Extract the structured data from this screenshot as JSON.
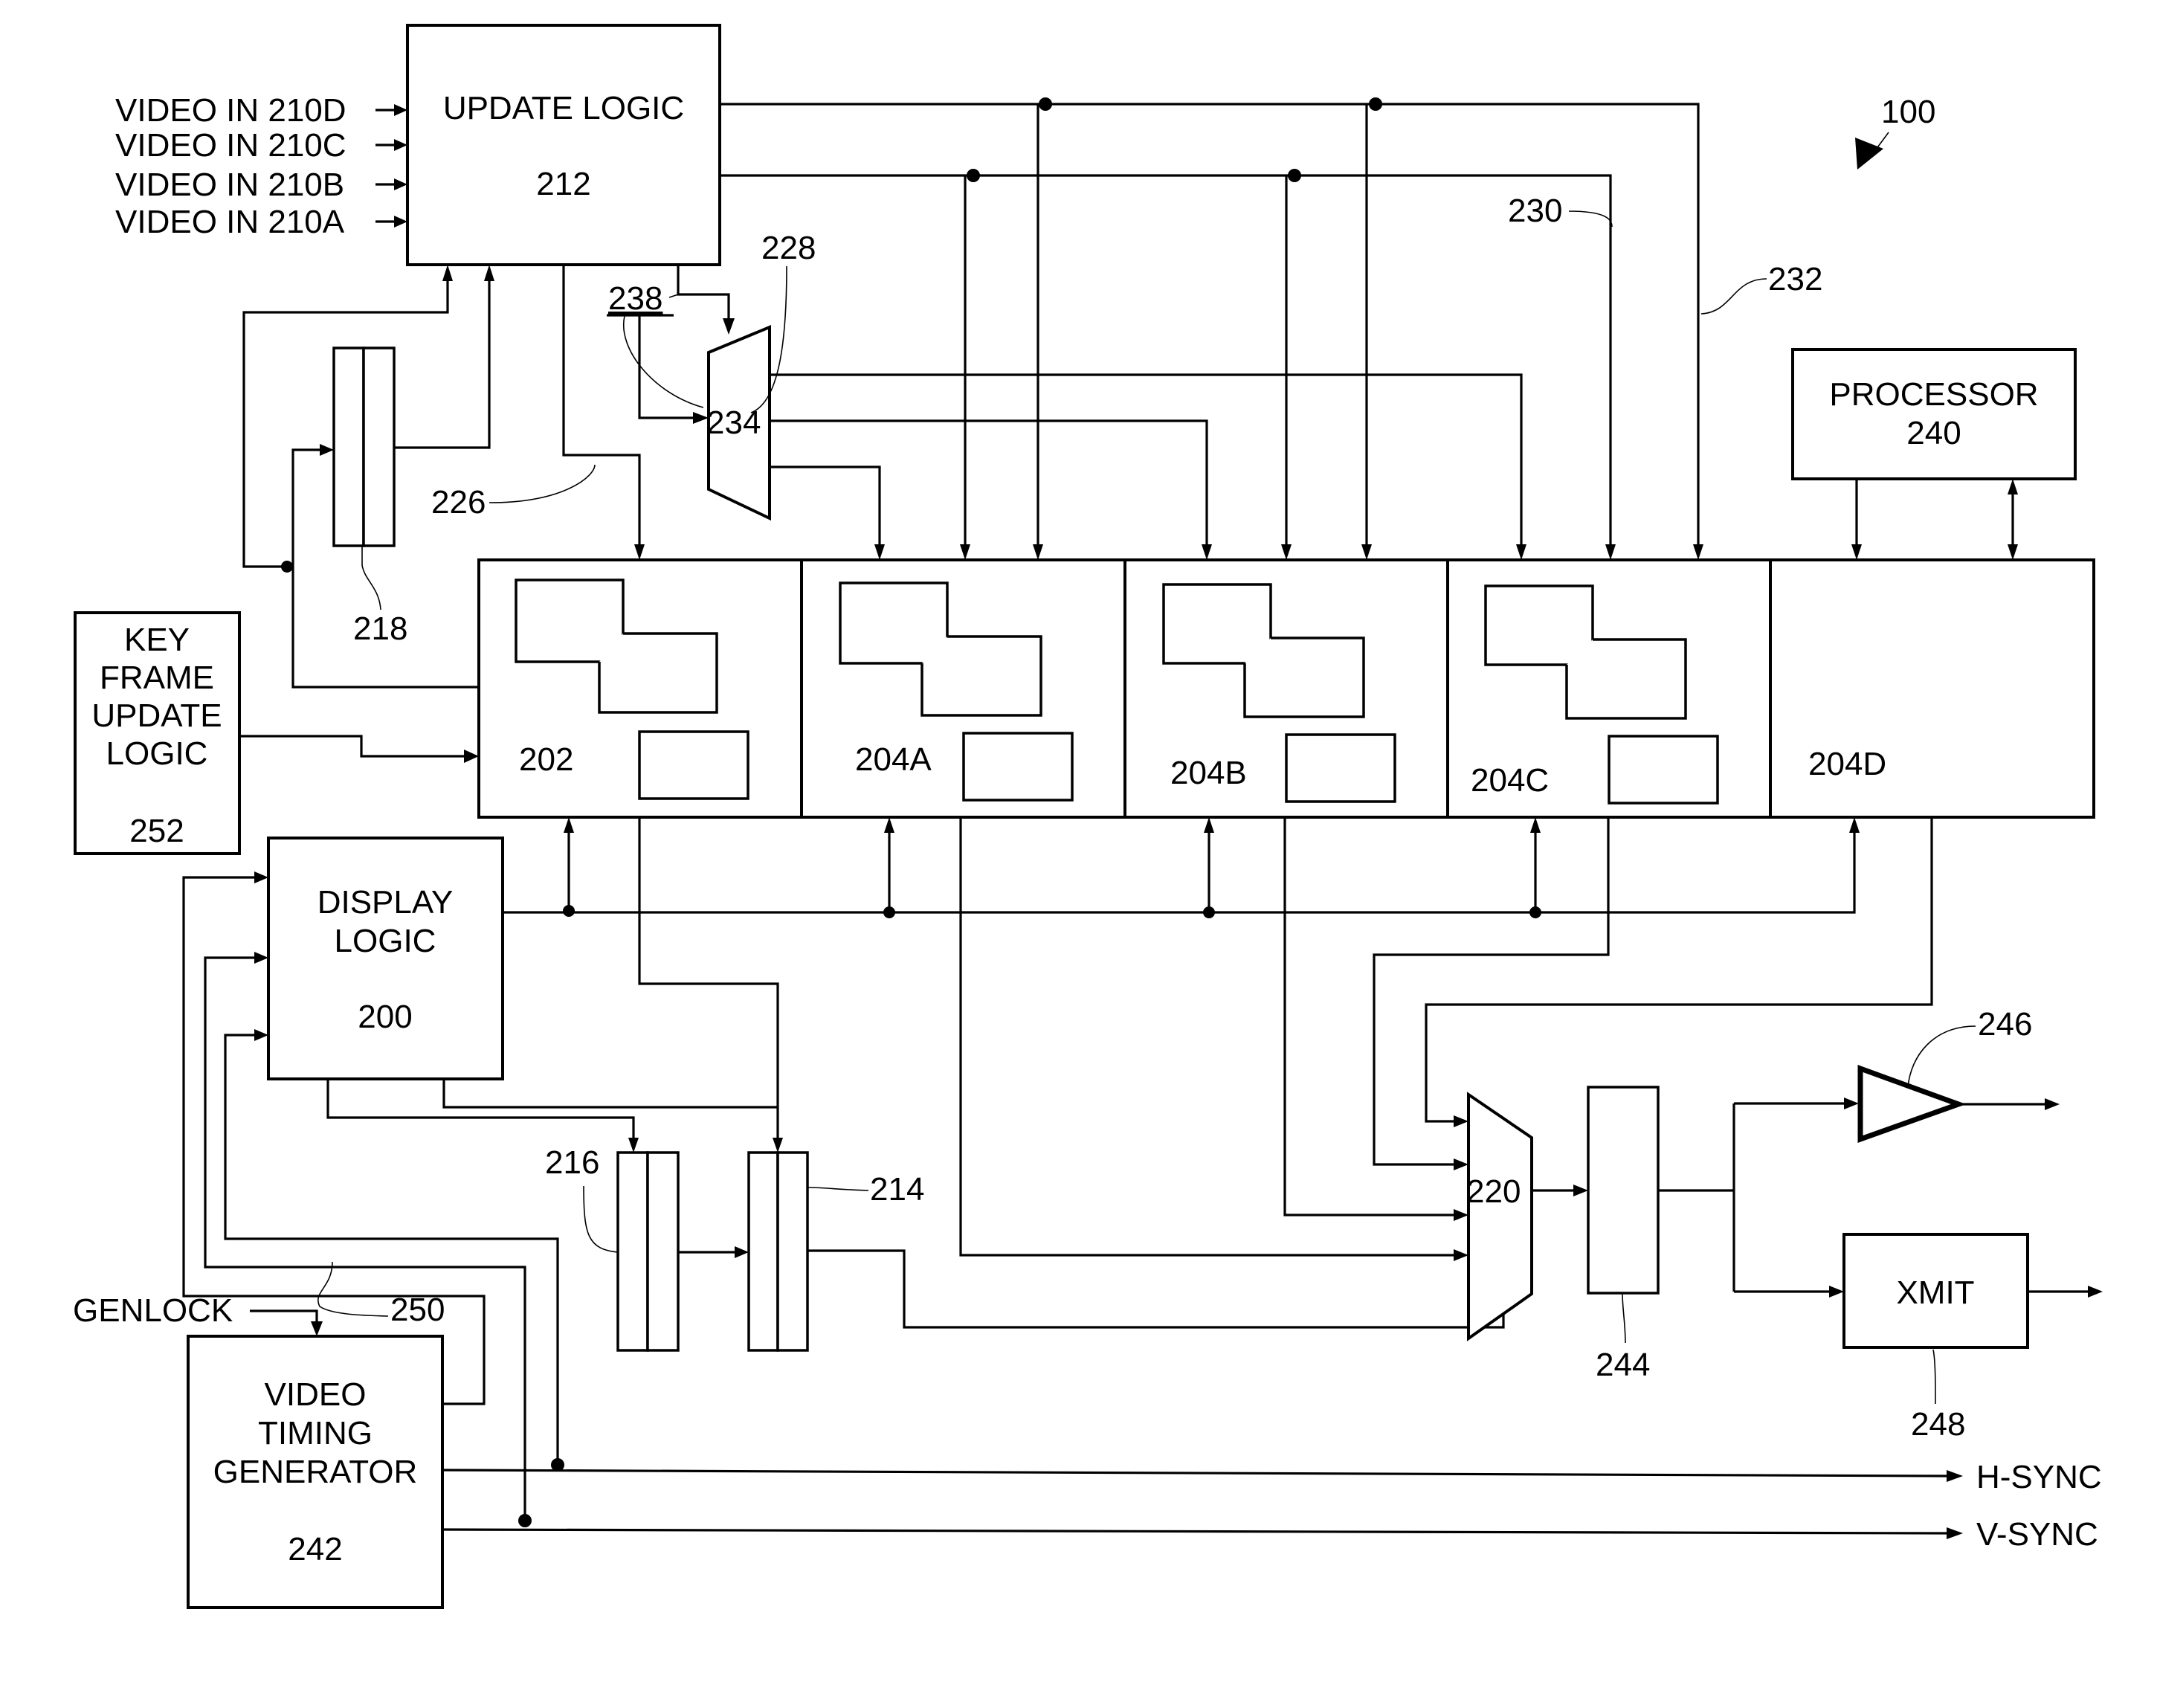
{
  "figure": {
    "reference": "100"
  },
  "inputs": [
    {
      "label": "VIDEO IN 210D"
    },
    {
      "label": "VIDEO IN 210C"
    },
    {
      "label": "VIDEO IN 210B"
    },
    {
      "label": "VIDEO IN 210A"
    }
  ],
  "blocks": {
    "update_logic": {
      "title": "UPDATE LOGIC",
      "ref": "212"
    },
    "processor": {
      "title": "PROCESSOR",
      "ref": "240"
    },
    "key_frame": {
      "line1": "KEY",
      "line2": "FRAME",
      "line3": "UPDATE",
      "line4": "LOGIC",
      "ref": "252"
    },
    "display_logic": {
      "line1": "DISPLAY",
      "line2": "LOGIC",
      "ref": "200"
    },
    "vtg": {
      "line1": "VIDEO",
      "line2": "TIMING",
      "line3": "GENERATOR",
      "ref": "242"
    },
    "xmit": {
      "title": "XMIT",
      "ref": "248"
    }
  },
  "memories": [
    {
      "ref": "202"
    },
    {
      "ref": "204A"
    },
    {
      "ref": "204B"
    },
    {
      "ref": "204C"
    },
    {
      "ref": "204D"
    }
  ],
  "refs": {
    "mux_select": "234",
    "mux_out": "220",
    "reg_218": "218",
    "reg_216": "216",
    "reg_214": "214",
    "reg_244": "244",
    "amp_246": "246",
    "bus_226": "226",
    "bus_228": "228",
    "bus_230": "230",
    "bus_232": "232",
    "sel_238": "238",
    "bus_250": "250"
  },
  "signals": {
    "genlock": "GENLOCK",
    "hsync": "H-SYNC",
    "vsync": "V-SYNC"
  }
}
